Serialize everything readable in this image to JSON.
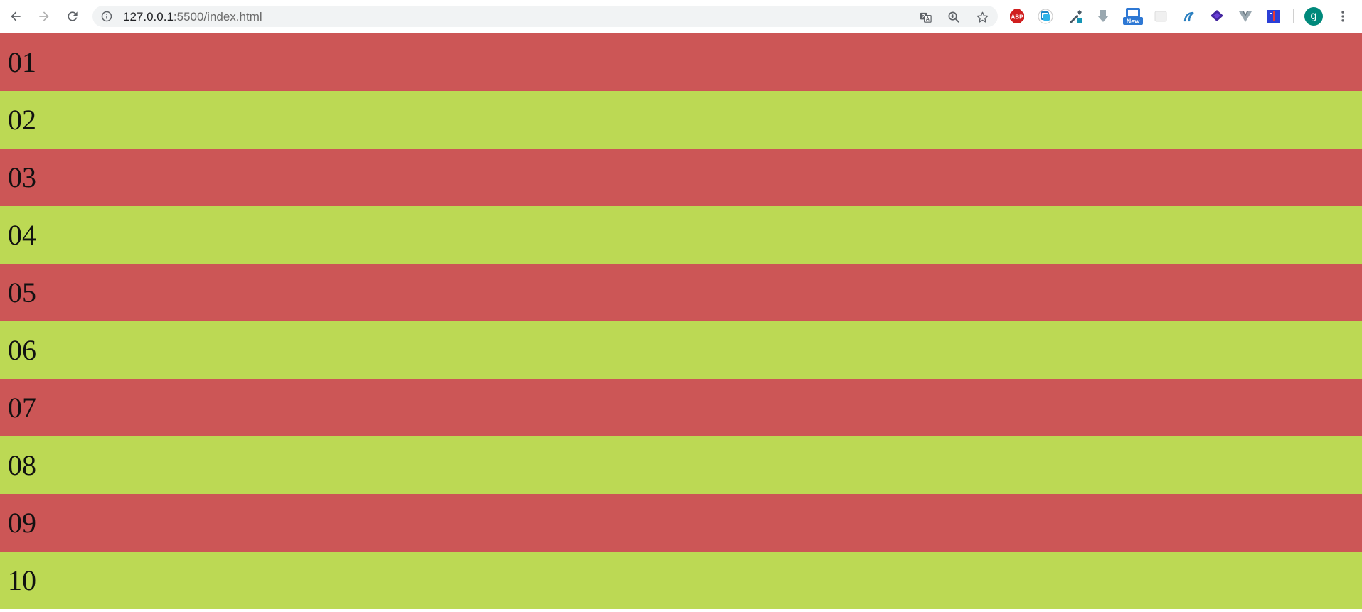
{
  "browser": {
    "url_host": "127.0.0.1",
    "url_rest": ":5500/index.html",
    "account_initial": "g",
    "icons": {
      "back": "arrow-left-icon",
      "forward": "arrow-right-icon",
      "reload": "reload-icon",
      "info": "info-icon",
      "translate": "translate-icon",
      "zoom": "zoom-icon",
      "bookmark": "star-icon",
      "menu": "kebab-menu-icon"
    },
    "extensions": [
      {
        "name": "adblock-plus-icon",
        "label": "ABP"
      },
      {
        "name": "sync-extension-icon"
      },
      {
        "name": "eyedropper-extension-icon"
      },
      {
        "name": "download-extension-icon"
      },
      {
        "name": "screenshot-extension-icon",
        "badge": "New"
      },
      {
        "name": "blank-extension-icon"
      },
      {
        "name": "script-extension-icon"
      },
      {
        "name": "layers-extension-icon"
      },
      {
        "name": "vue-devtools-icon"
      },
      {
        "name": "book-extension-icon"
      }
    ]
  },
  "rows": [
    "01",
    "02",
    "03",
    "04",
    "05",
    "06",
    "07",
    "08",
    "09",
    "10"
  ],
  "colors": {
    "odd_row": "#cc5656",
    "even_row": "#bcd954",
    "avatar": "#00897b"
  }
}
